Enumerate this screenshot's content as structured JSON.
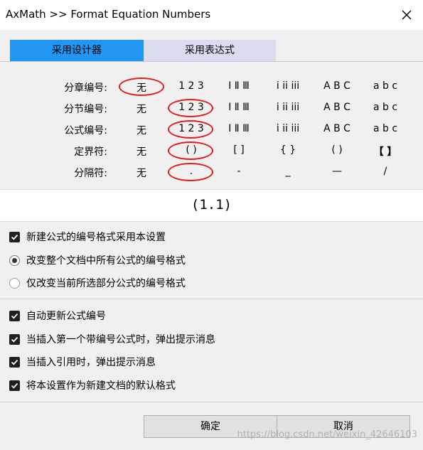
{
  "window": {
    "title": "AxMath >> Format Equation Numbers",
    "close_glyph": "✕"
  },
  "tabs": [
    {
      "label": "采用设计器",
      "active": true
    },
    {
      "label": "采用表达式",
      "active": false
    }
  ],
  "grid": {
    "rows": [
      {
        "label": "分章编号:",
        "options": [
          "无",
          "1 2 3",
          "Ⅰ Ⅱ Ⅲ",
          "i ii iii",
          "A B C",
          "a b c"
        ],
        "selected": 0
      },
      {
        "label": "分节编号:",
        "options": [
          "无",
          "1 2 3",
          "Ⅰ Ⅱ Ⅲ",
          "i ii iii",
          "A B C",
          "a b c"
        ],
        "selected": 1
      },
      {
        "label": "公式编号:",
        "options": [
          "无",
          "1 2 3",
          "Ⅰ Ⅱ Ⅲ",
          "i ii iii",
          "A B C",
          "a b c"
        ],
        "selected": 1
      },
      {
        "label": "定界符:",
        "options": [
          "无",
          "(   )",
          "[   ]",
          "{   }",
          "(   )",
          "【  】"
        ],
        "selected": 1
      },
      {
        "label": "分隔符:",
        "options": [
          "无",
          ".",
          "-",
          "_",
          "—",
          "/"
        ],
        "selected": 1
      }
    ]
  },
  "preview": {
    "text": "(1.1)"
  },
  "options": {
    "apply_new": {
      "label": "新建公式的编号格式采用本设置",
      "checked": true
    },
    "scope_all": {
      "label": "改变整个文档中所有公式的编号格式",
      "checked": true
    },
    "scope_selected": {
      "label": "仅改变当前所选部分公式的编号格式",
      "checked": false
    },
    "auto_update": {
      "label": "自动更新公式编号",
      "checked": true
    },
    "prompt_first": {
      "label": "当插入第一个带编号公式时，弹出提示消息",
      "checked": true
    },
    "prompt_ref": {
      "label": "当插入引用时，弹出提示消息",
      "checked": true
    },
    "as_default": {
      "label": "将本设置作为新建文档的默认格式",
      "checked": true
    }
  },
  "buttons": {
    "ok": "确定",
    "cancel": "取消"
  },
  "watermark": "https://blog.csdn.net/weixin_42646103",
  "colors": {
    "tab_active": "#2196f3",
    "tab_inactive": "#dcdcf0",
    "selection_ring": "#e11d1d"
  }
}
